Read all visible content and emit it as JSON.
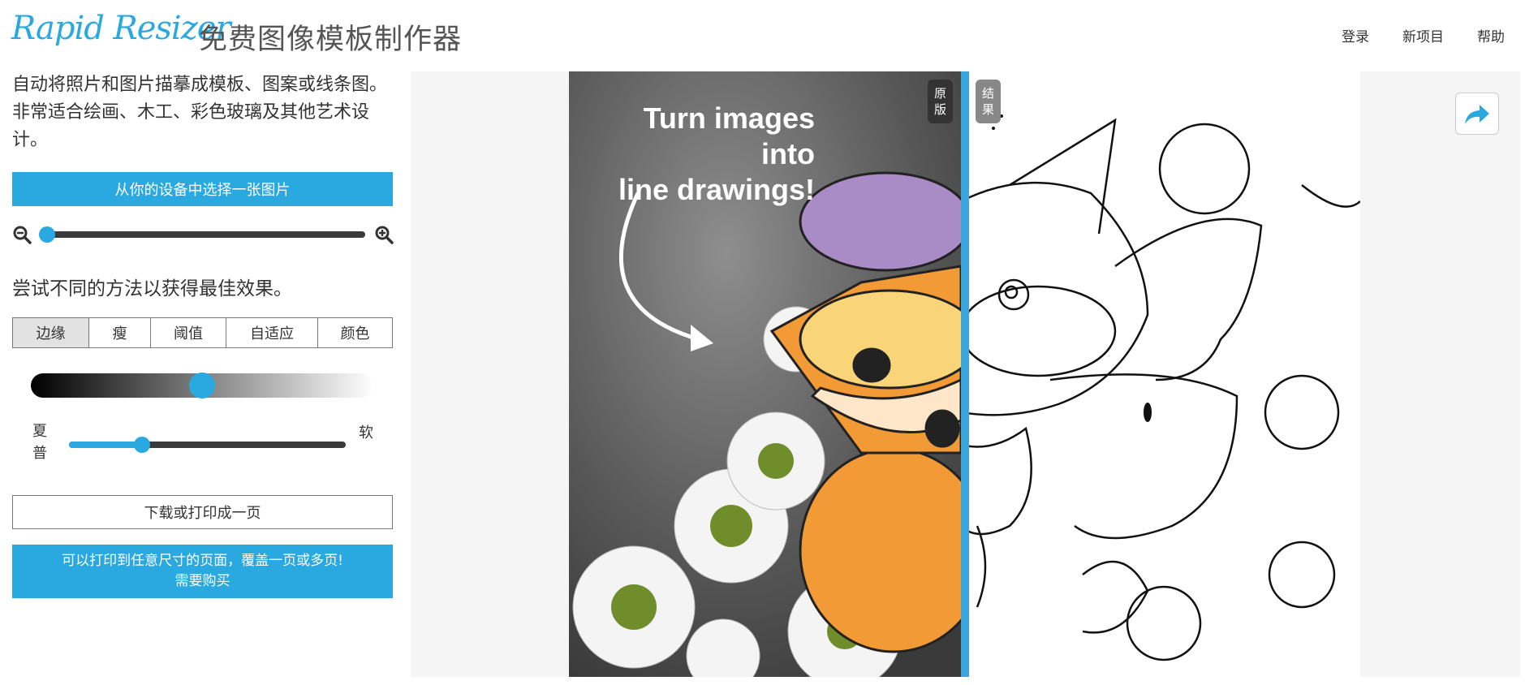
{
  "header": {
    "logo_text": "Rapid Resizer",
    "title": "免费图像模板制作器",
    "nav": {
      "login": "登录",
      "new_project": "新项目",
      "help": "帮助"
    }
  },
  "sidebar": {
    "description": "自动将照片和图片描摹成模板、图案或线条图。非常适合绘画、木工、彩色玻璃及其他艺术设计。",
    "choose_button": "从你的设备中选择一张图片",
    "zoom_level": 0,
    "methods_label": "尝试不同的方法以获得最佳效果。",
    "tabs": [
      {
        "label": "边缘",
        "active": true
      },
      {
        "label": "瘦",
        "active": false
      },
      {
        "label": "阈值",
        "active": false
      },
      {
        "label": "自适应",
        "active": false
      },
      {
        "label": "颜色",
        "active": false
      }
    ],
    "edge_level": 0.46,
    "sharp_label": "夏普",
    "soft_label": "软",
    "softness_level": 0.27,
    "download_button": "下载或打印成一页",
    "print_button_line1": "可以打印到任意尺寸的页面，覆盖一页或多页!",
    "print_button_line2": "需要购买"
  },
  "preview": {
    "overlay_text": "Turn images into\nline drawings!",
    "tag_original": "原版",
    "tag_result": "结果",
    "share_icon": "share-arrow-icon"
  },
  "colors": {
    "accent": "#2aa8e0",
    "divider": "#3aa6dc"
  }
}
